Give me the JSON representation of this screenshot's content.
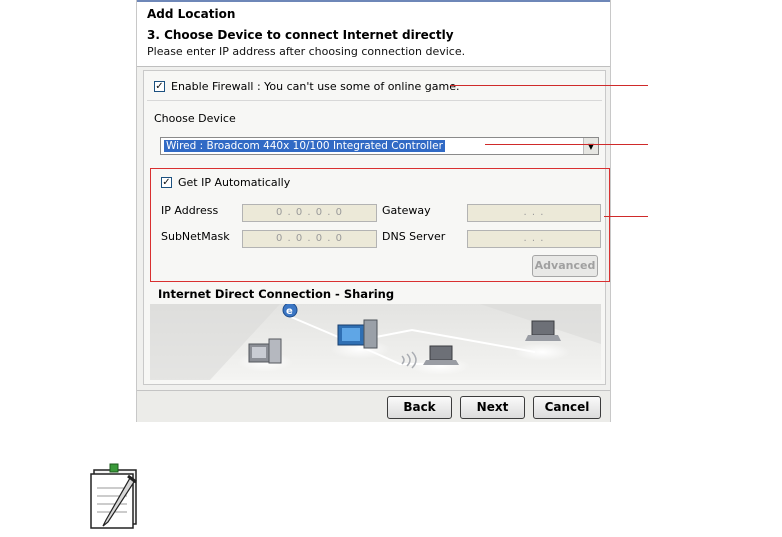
{
  "dialog": {
    "title": "Add Location",
    "step": "3. Choose Device to connect Internet directly",
    "description": "Please enter IP address after choosing connection device."
  },
  "firewall": {
    "checked": true,
    "label": "Enable Firewall : You can't use some of online game."
  },
  "device": {
    "label": "Choose Device",
    "selected": "Wired : Broadcom 440x 10/100 Integrated Controller"
  },
  "ip": {
    "auto_label": "Get IP Automatically",
    "auto_checked": true,
    "ip_label": "IP Address",
    "ip_value": "0 . 0 . 0 . 0",
    "subnet_label": "SubNetMask",
    "subnet_value": "0 . 0 . 0 . 0",
    "gateway_label": "Gateway",
    "gateway_value": ". . .",
    "dns_label": "DNS Server",
    "dns_value": ". . .",
    "advanced_label": "Advanced"
  },
  "sharing": {
    "title": "Internet Direct Connection - Sharing"
  },
  "footer": {
    "back_label": "Back",
    "next_label": "Next",
    "cancel_label": "Cancel"
  },
  "colors": {
    "annotation": "#cf2a2a",
    "selection": "#316ac5",
    "title_bar": "#6e87b8"
  },
  "icons": {
    "checkbox": "checkmark",
    "note": "notepad-pen-icon"
  }
}
